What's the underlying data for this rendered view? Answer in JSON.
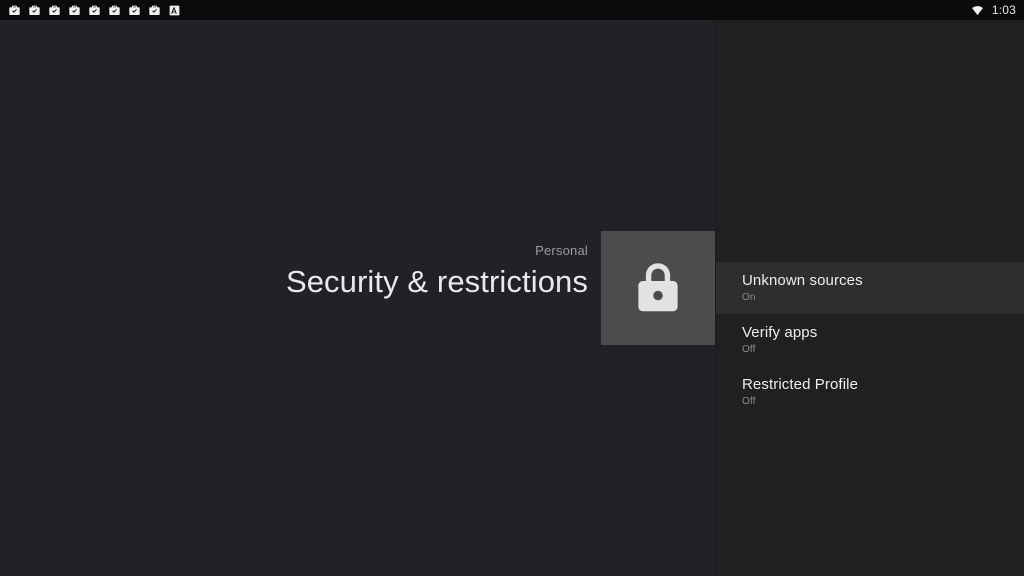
{
  "status_bar": {
    "notification_icons": [
      {
        "name": "work-app-installed-icon",
        "glyph": "briefcase-check"
      },
      {
        "name": "work-app-installed-icon",
        "glyph": "briefcase-check"
      },
      {
        "name": "work-app-installed-icon",
        "glyph": "briefcase-check"
      },
      {
        "name": "work-app-installed-icon",
        "glyph": "briefcase-check"
      },
      {
        "name": "work-app-installed-icon",
        "glyph": "briefcase-check"
      },
      {
        "name": "work-app-installed-icon",
        "glyph": "briefcase-check"
      },
      {
        "name": "work-app-installed-icon",
        "glyph": "briefcase-check"
      },
      {
        "name": "work-app-installed-icon",
        "glyph": "briefcase-check"
      },
      {
        "name": "app-badge-icon",
        "glyph": "letter-a-badge"
      }
    ],
    "wifi_icon": "wifi-icon",
    "clock": "1:03"
  },
  "hero": {
    "eyebrow": "Personal",
    "title": "Security & restrictions",
    "icon": "lock-icon"
  },
  "panel": {
    "items": [
      {
        "title": "Unknown sources",
        "status": "On",
        "selected": true
      },
      {
        "title": "Verify apps",
        "status": "Off",
        "selected": false
      },
      {
        "title": "Restricted Profile",
        "status": "Off",
        "selected": false
      }
    ]
  },
  "colors": {
    "background": "#212227",
    "panel_background": "#202020",
    "selected_row": "#2e2e2e",
    "tile": "#4c4c4c",
    "primary_text": "#ededed",
    "secondary_text": "#8b8b8b",
    "status_bar": "#0b0b0b"
  }
}
